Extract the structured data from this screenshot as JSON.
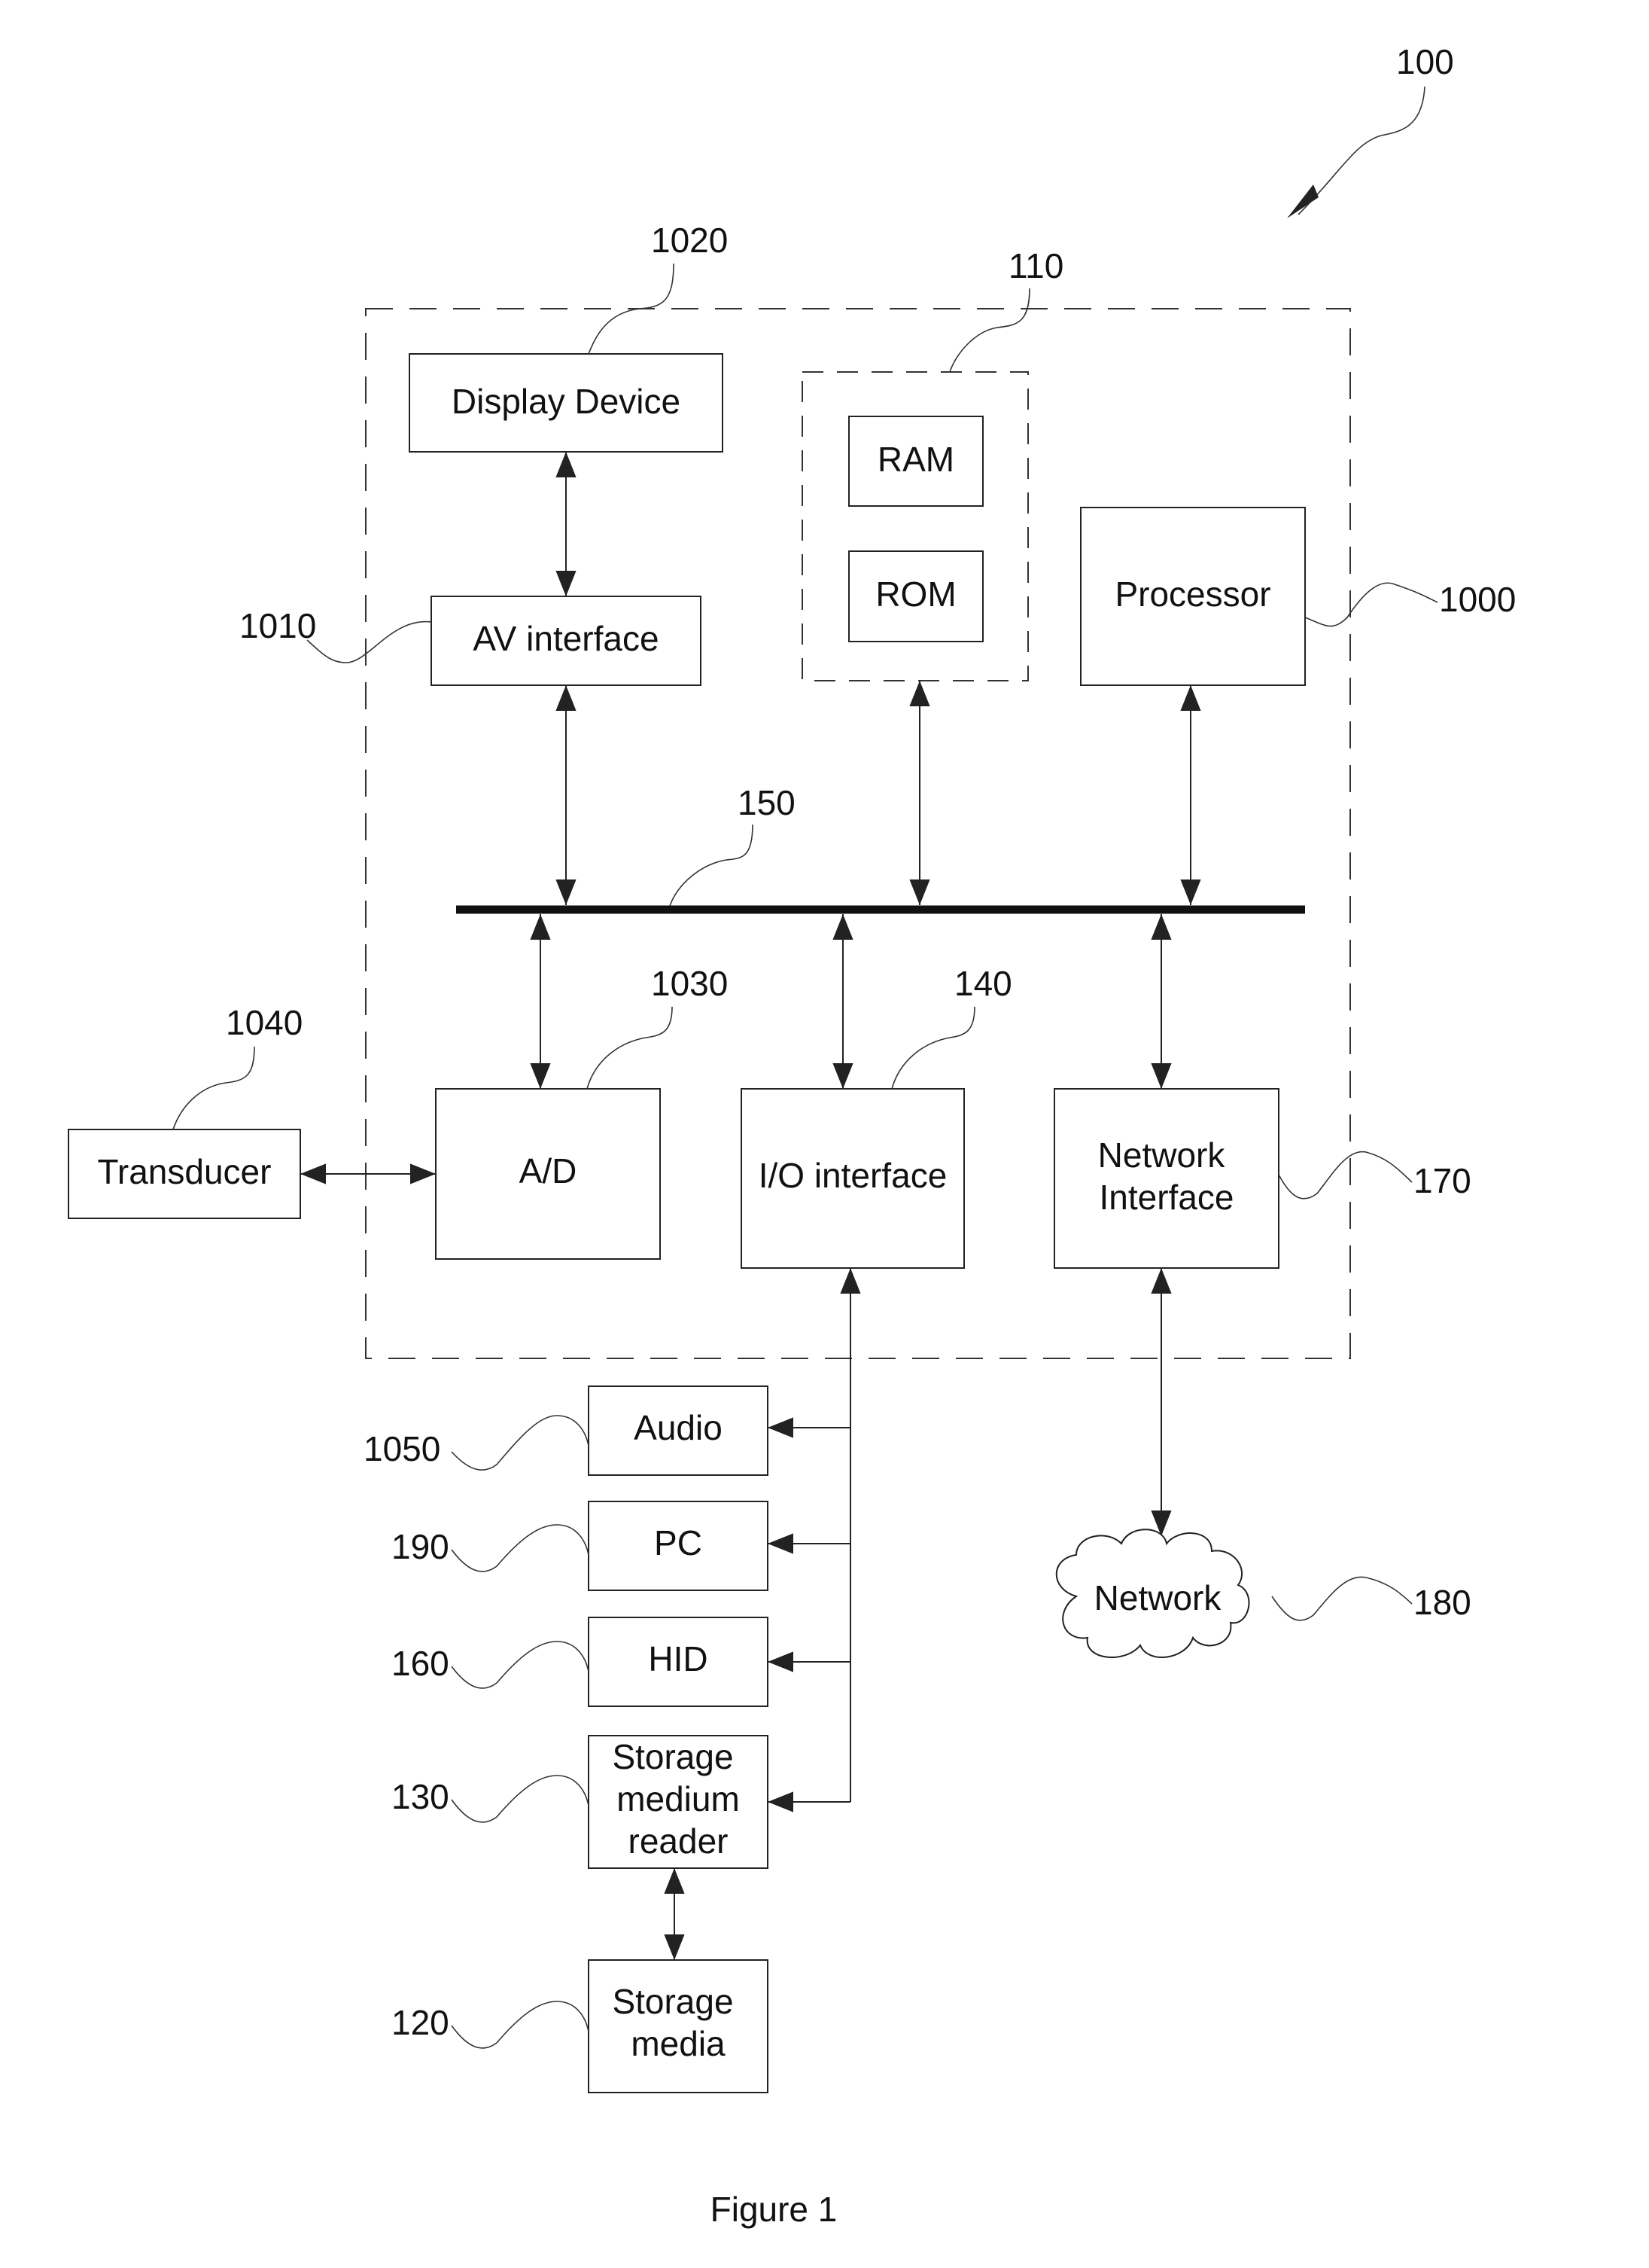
{
  "figure": {
    "caption": "Figure 1",
    "system_ref": "100"
  },
  "components": {
    "display_device": {
      "label": "Display Device",
      "ref": "1020"
    },
    "av_interface": {
      "label": "AV interface",
      "ref": "1010"
    },
    "memory": {
      "ref": "110",
      "ram": "RAM",
      "rom": "ROM"
    },
    "processor": {
      "label": "Processor",
      "ref": "1000"
    },
    "bus": {
      "ref": "150"
    },
    "ad": {
      "label": "A/D",
      "ref": "1030"
    },
    "io_interface": {
      "label": "I/O interface",
      "ref": "140"
    },
    "network_interface": {
      "label_line1": "Network",
      "label_line2": "Interface",
      "ref": "170"
    },
    "transducer": {
      "label": "Transducer",
      "ref": "1040"
    },
    "audio": {
      "label": "Audio",
      "ref": "1050"
    },
    "pc": {
      "label": "PC",
      "ref": "190"
    },
    "hid": {
      "label": "HID",
      "ref": "160"
    },
    "storage_reader": {
      "line1": "Storage",
      "line2": "medium",
      "line3": "reader",
      "ref": "130"
    },
    "storage_media": {
      "line1": "Storage",
      "line2": "media",
      "ref": "120"
    },
    "network": {
      "label": "Network",
      "ref": "180"
    }
  }
}
